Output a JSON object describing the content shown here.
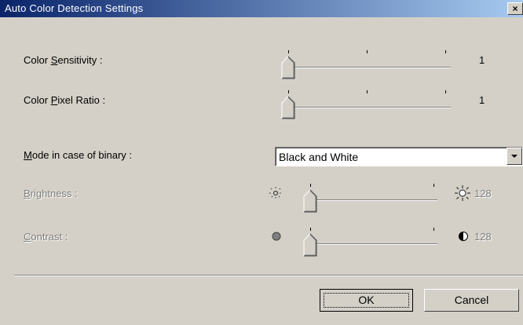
{
  "window": {
    "title": "Auto Color Detection Settings",
    "close_label": "×"
  },
  "settings": {
    "color_sensitivity": {
      "label_pre": "Color ",
      "label_access": "S",
      "label_post": "ensitivity :",
      "value": "1",
      "level": 0
    },
    "color_pixel_ratio": {
      "label_pre": "Color ",
      "label_access": "P",
      "label_post": "ixel Ratio :",
      "value": "1",
      "level": 0
    },
    "mode_binary": {
      "label_access": "M",
      "label_post": "ode in case of binary :",
      "selected": "Black and White"
    },
    "brightness": {
      "label_access": "B",
      "label_post": "rightness :",
      "value": "128",
      "enabled": false,
      "level": 0,
      "left_icon": "sun-dim-icon",
      "right_icon": "sun-bright-icon"
    },
    "contrast": {
      "label_access": "C",
      "label_post": "ontrast :",
      "value": "128",
      "enabled": false,
      "level": 0,
      "left_icon": "contrast-low-icon",
      "right_icon": "contrast-high-icon"
    }
  },
  "buttons": {
    "ok": "OK",
    "cancel": "Cancel"
  }
}
